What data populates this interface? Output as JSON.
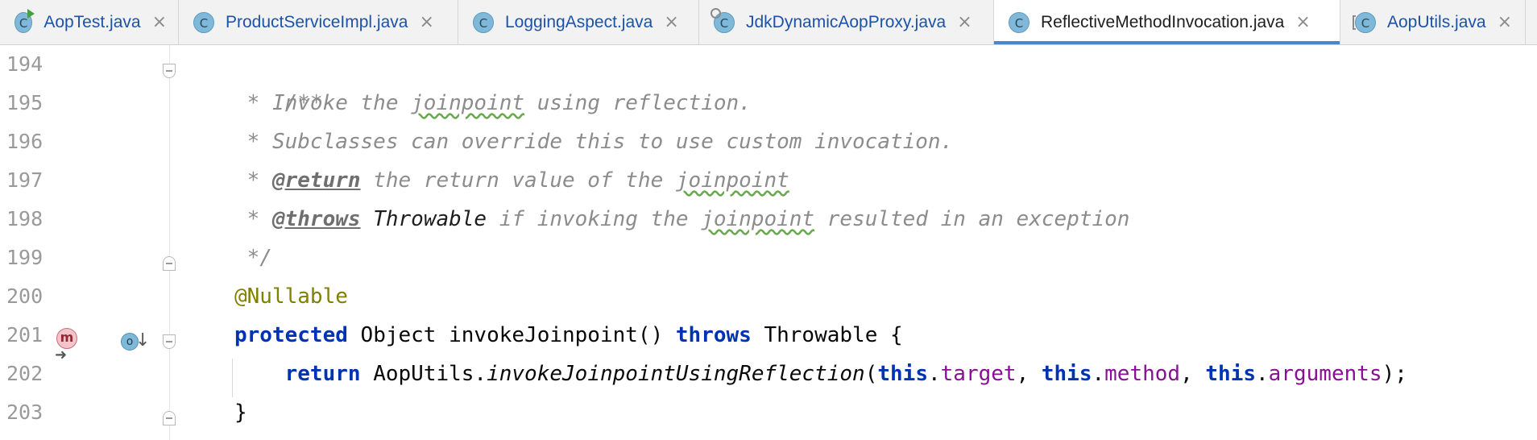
{
  "tabs": [
    {
      "label": "AopTest.java",
      "icon": "C",
      "badge": "run",
      "close": "×",
      "active": false
    },
    {
      "label": "ProductServiceImpl.java",
      "icon": "C",
      "badge": "",
      "close": "×",
      "active": false
    },
    {
      "label": "LoggingAspect.java",
      "icon": "C",
      "badge": "",
      "close": "×",
      "active": false
    },
    {
      "label": "JdkDynamicAopProxy.java",
      "icon": "C",
      "badge": "lock",
      "close": "×",
      "active": false
    },
    {
      "label": "ReflectiveMethodInvocation.java",
      "icon": "C",
      "badge": "",
      "close": "×",
      "active": true
    },
    {
      "label": "AopUtils.java",
      "icon": "C",
      "badge": "abstract",
      "close": "×",
      "active": false
    }
  ],
  "gutter": {
    "line_numbers": [
      "194",
      "195",
      "196",
      "197",
      "198",
      "199",
      "200",
      "201",
      "202",
      "203"
    ],
    "method_marker": "m",
    "override_marker": "o",
    "down_arrow": "↓",
    "right_arrow": "➜"
  },
  "code": {
    "l194": "/**",
    "l195_a": " * Invoke the ",
    "l195_b": "joinpoint",
    "l195_c": " using reflection.",
    "l196": " * Subclasses can override this to use custom invocation.",
    "l197_a": " * ",
    "l197_tag": "@return",
    "l197_b": " the return value of the ",
    "l197_c": "joinpoint",
    "l198_a": " * ",
    "l198_tag": "@throws",
    "l198_ref": " Throwable",
    "l198_b": " if invoking the ",
    "l198_c": "joinpoint",
    "l198_d": " resulted in an exception",
    "l199": " */",
    "l200": "@Nullable",
    "l201_kw1": "protected",
    "l201_a": " Object invokeJoinpoint() ",
    "l201_kw2": "throws",
    "l201_b": " Throwable {",
    "l202_indent": "    ",
    "l202_kw": "return",
    "l202_a": " AopUtils.",
    "l202_method": "invokeJoinpointUsingReflection",
    "l202_b": "(",
    "l202_this1": "this",
    "l202_dot1": ".",
    "l202_f1": "target",
    "l202_c": ", ",
    "l202_this2": "this",
    "l202_dot2": ".",
    "l202_f2": "method",
    "l202_d": ", ",
    "l202_this3": "this",
    "l202_dot3": ".",
    "l202_f3": "arguments",
    "l202_e": ");",
    "l203": "}"
  },
  "colors": {
    "keyword": "#0033b3",
    "field": "#871094",
    "annotation": "#808000",
    "doc_comment": "#8c8c8c",
    "active_tab_underline": "#4a86c8",
    "tab_label": "#1c52a8"
  }
}
